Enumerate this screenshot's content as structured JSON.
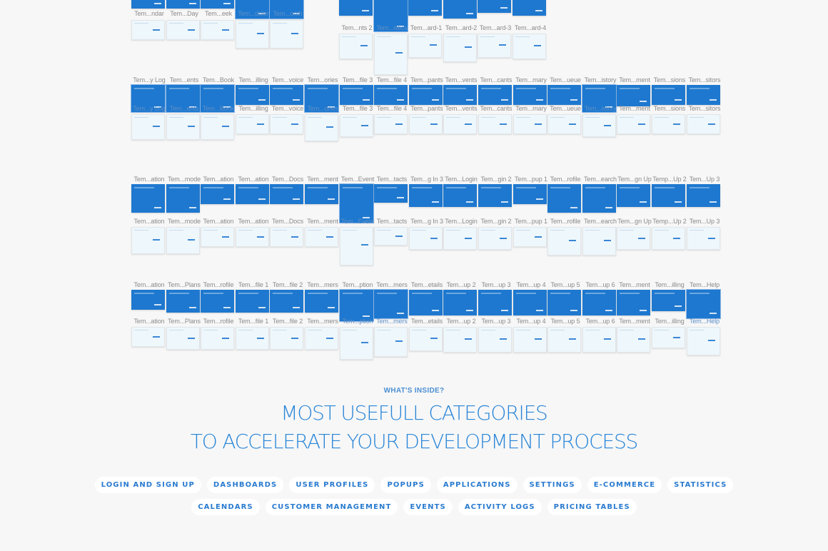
{
  "thumbnail_rows": [
    {
      "cells": [
        {
          "label": "Tem...ndar"
        },
        {
          "label": "Tem...Day"
        },
        {
          "label": "Tem...eek"
        },
        {
          "label": "Tem...duler",
          "selected": true
        },
        {
          "label": "Tem...onth",
          "selected": true
        }
      ]
    },
    {
      "cells": [
        {
          "label": "Tem...nts 2"
        },
        {
          "label": "Tem...istics",
          "selected": true
        },
        {
          "label": "Tem...ard-1"
        },
        {
          "label": "Tem...ard-2"
        },
        {
          "label": "Tem...ard-3"
        },
        {
          "label": "Tem...ard-4"
        }
      ]
    },
    {
      "cells": [
        {
          "label": "Tem...y Log",
          "selected": true
        },
        {
          "label": "Tem...ents",
          "selected": true
        },
        {
          "label": "Tem...Book",
          "selected": true
        },
        {
          "label": "Tem...illing"
        },
        {
          "label": "Tem...voice"
        },
        {
          "label": "Tem...ories",
          "selected": true
        },
        {
          "label": "Tem...file 3"
        },
        {
          "label": "Tem...file 4"
        },
        {
          "label": "Tem...pants"
        },
        {
          "label": "Tem...vents"
        },
        {
          "label": "Tem...cants"
        },
        {
          "label": "Tem...mary"
        },
        {
          "label": "Tem...ueue"
        },
        {
          "label": "Tem...istory",
          "selected": true
        },
        {
          "label": "Tem...ment"
        },
        {
          "label": "Tem...sions"
        },
        {
          "label": "Tem...sitors"
        }
      ]
    },
    {
      "cells": [
        {
          "label": "Tem...ation"
        },
        {
          "label": "Tem...mode"
        },
        {
          "label": "Tem...ation"
        },
        {
          "label": "Tem...ation"
        },
        {
          "label": "Tem...Docs"
        },
        {
          "label": "Tem...ment"
        },
        {
          "label": "Tem...Event",
          "selected": true
        },
        {
          "label": "Tem...tacts"
        },
        {
          "label": "Tem...g In 3"
        },
        {
          "label": "Tem...Login"
        },
        {
          "label": "Tem...gin 2"
        },
        {
          "label": "Tem...pup 1"
        },
        {
          "label": "Tem...rofile"
        },
        {
          "label": "Tem...earch"
        },
        {
          "label": "Tem...gn Up"
        },
        {
          "label": "Temp...Up 2"
        },
        {
          "label": "Tem...Up 3"
        }
      ]
    },
    {
      "cells": [
        {
          "label": "Tem...ation"
        },
        {
          "label": "Tem...Plans"
        },
        {
          "label": "Tem...rofile"
        },
        {
          "label": "Tem...file 1"
        },
        {
          "label": "Tem...file 2"
        },
        {
          "label": "Tem...mers"
        },
        {
          "label": "Tem...ption",
          "selected": true
        },
        {
          "label": "Tem...mers",
          "selected": true
        },
        {
          "label": "Tem...etails"
        },
        {
          "label": "Tem...up 2"
        },
        {
          "label": "Tem...up 3"
        },
        {
          "label": "Tem...up 4"
        },
        {
          "label": "Tem...up 5"
        },
        {
          "label": "Tem...up 6"
        },
        {
          "label": "Tem...ment"
        },
        {
          "label": "Tem...illing"
        },
        {
          "label": "Tem...Help",
          "selected": true
        }
      ]
    }
  ],
  "section": {
    "eyebrow": "WHAT'S INSIDE?",
    "headline_line1": "MOST USEFULL CATEGORIES",
    "headline_line2": "TO ACCELERATE YOUR DEVELOPMENT PROCESS"
  },
  "categories_row1": [
    "LOGIN AND SIGN UP",
    "DASHBOARDS",
    "USER PROFILES",
    "POPUPS",
    "APPLICATIONS",
    "SETTINGS",
    "E-COMMERCE",
    "STATISTICS"
  ],
  "categories_row2": [
    "CALENDARS",
    "CUSTOMER MANAGEMENT",
    "EVENTS",
    "ACTIVITY LOGS",
    "PRICING TABLES"
  ],
  "colors": {
    "accent": "#2a86d8",
    "thumb_blue": "#1e78cf",
    "thumb_light": "#eef7fb",
    "background": "#f7f7f7"
  }
}
